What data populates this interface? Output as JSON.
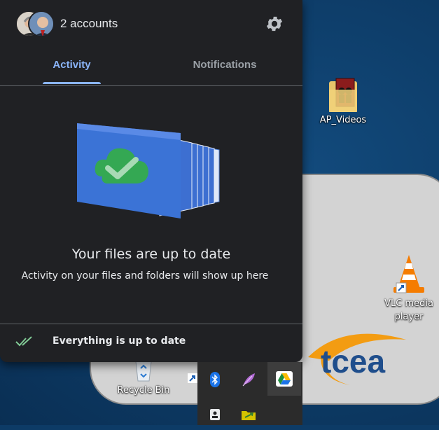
{
  "panel": {
    "accounts_label": "2 accounts",
    "tabs": [
      {
        "label": "Activity",
        "active": true
      },
      {
        "label": "Notifications",
        "active": false
      }
    ],
    "empty_state": {
      "title": "Your files are up to date",
      "subtitle": "Activity on your files and folders will show up here"
    },
    "status": "Everything is up to date"
  },
  "desktop": {
    "icons": [
      {
        "label": "AP_Videos"
      },
      {
        "label": "VLC media player"
      },
      {
        "label": "Recycle Bin"
      }
    ],
    "wallpaper_logo": "tcea"
  },
  "tray": {
    "icons": [
      "bluetooth-icon",
      "feather-icon",
      "google-drive-icon",
      "security-key-icon",
      "folder-sync-icon"
    ]
  },
  "colors": {
    "panel_bg": "#202124",
    "accent": "#8ab4f8",
    "check_green": "#81c995",
    "desktop_bg": "#0d3b66"
  }
}
